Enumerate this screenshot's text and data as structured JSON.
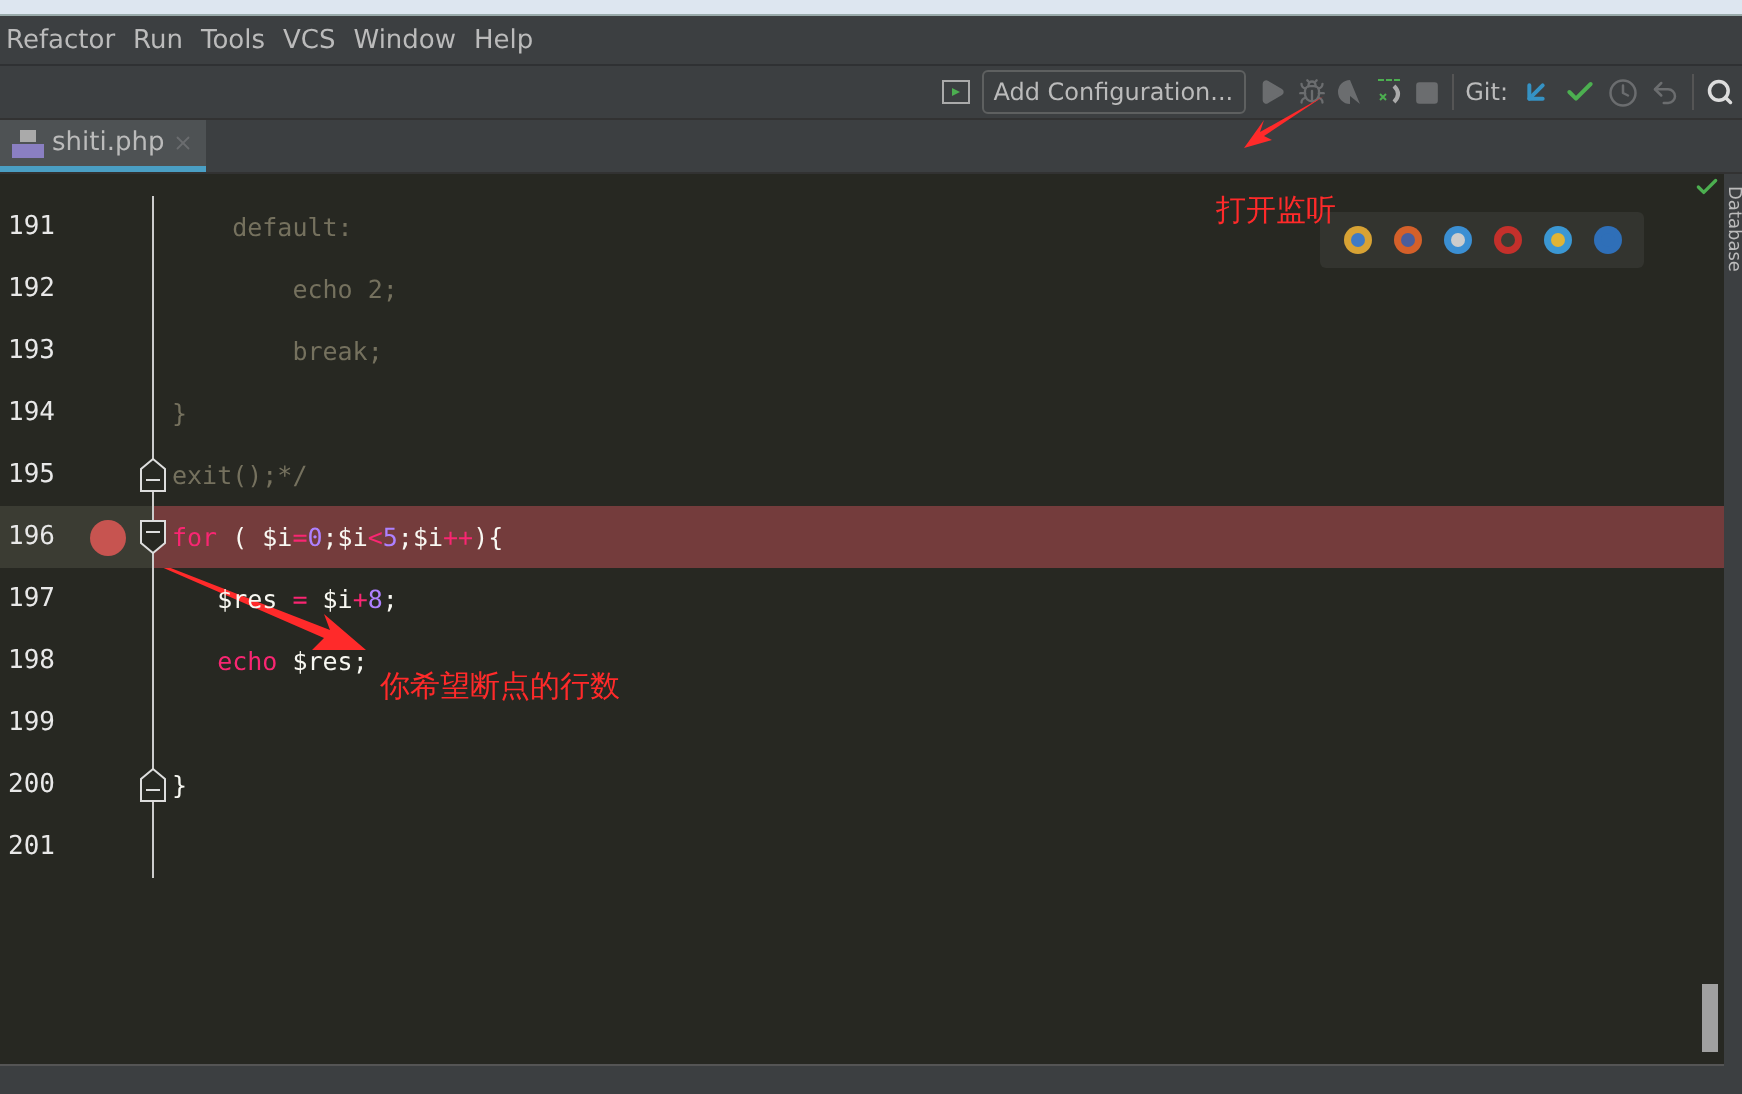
{
  "menu": [
    "Refactor",
    "Run",
    "Tools",
    "VCS",
    "Window",
    "Help"
  ],
  "toolbar": {
    "config_button": "Add Configuration...",
    "git_label": "Git:"
  },
  "tabs": [
    {
      "label": "shiti.php",
      "selected": true
    }
  ],
  "side_panel": "Database",
  "lines": [
    {
      "number": "191",
      "breakpoint": false,
      "highlighted": false,
      "segments": [
        {
          "kind": "comment",
          "text": "    default:"
        }
      ]
    },
    {
      "number": "192",
      "breakpoint": false,
      "highlighted": false,
      "segments": [
        {
          "kind": "comment",
          "text": "        echo 2;"
        }
      ]
    },
    {
      "number": "193",
      "breakpoint": false,
      "highlighted": false,
      "segments": [
        {
          "kind": "comment",
          "text": "        break;"
        }
      ]
    },
    {
      "number": "194",
      "breakpoint": false,
      "highlighted": false,
      "segments": [
        {
          "kind": "comment",
          "text": "}"
        }
      ]
    },
    {
      "number": "195",
      "breakpoint": false,
      "fold_close": true,
      "highlighted": false,
      "segments": [
        {
          "kind": "comment",
          "text": "exit();*/"
        }
      ]
    },
    {
      "number": "196",
      "breakpoint": true,
      "fold_open": true,
      "highlighted": true,
      "segments": [
        {
          "kind": "keyword",
          "text": "for"
        },
        {
          "kind": "plain",
          "text": " ( $i"
        },
        {
          "kind": "op",
          "text": "="
        },
        {
          "kind": "num",
          "text": "0"
        },
        {
          "kind": "plain",
          "text": ";$i"
        },
        {
          "kind": "op",
          "text": "<"
        },
        {
          "kind": "num",
          "text": "5"
        },
        {
          "kind": "plain",
          "text": ";$i"
        },
        {
          "kind": "op",
          "text": "++"
        },
        {
          "kind": "plain",
          "text": "){"
        }
      ]
    },
    {
      "number": "197",
      "breakpoint": false,
      "highlighted": false,
      "segments": [
        {
          "kind": "plain",
          "text": "   $res "
        },
        {
          "kind": "op",
          "text": "="
        },
        {
          "kind": "plain",
          "text": " $i"
        },
        {
          "kind": "op",
          "text": "+"
        },
        {
          "kind": "num",
          "text": "8"
        },
        {
          "kind": "plain",
          "text": ";"
        }
      ]
    },
    {
      "number": "198",
      "breakpoint": false,
      "highlighted": false,
      "segments": [
        {
          "kind": "keyword",
          "text": "   echo"
        },
        {
          "kind": "plain",
          "text": " $res;"
        }
      ]
    },
    {
      "number": "199",
      "breakpoint": false,
      "highlighted": false
    },
    {
      "number": "200",
      "breakpoint": false,
      "fold_close": true,
      "highlighted": false,
      "segments": [
        {
          "kind": "plain",
          "text": "}"
        }
      ]
    },
    {
      "number": "201",
      "breakpoint": false,
      "highlighted": false
    }
  ],
  "annotations": [
    {
      "text": "打开监听"
    },
    {
      "text": "你希望断点的行数"
    }
  ]
}
